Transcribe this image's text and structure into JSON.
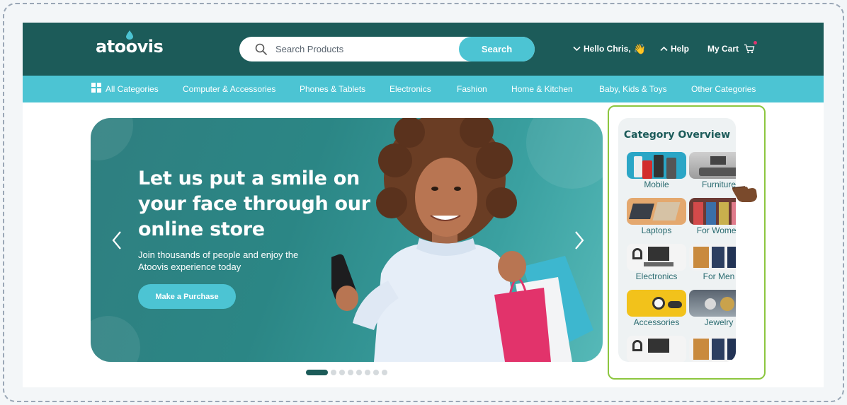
{
  "brand": {
    "logo_text": "atoovis"
  },
  "search": {
    "placeholder": "Search Products",
    "button_label": "Search"
  },
  "header": {
    "greeting": "Hello Chris,",
    "help_label": "Help",
    "cart_label": "My Cart"
  },
  "nav": {
    "all_categories": "All Categories",
    "items": [
      "Computer & Accessories",
      "Phones & Tablets",
      "Electronics",
      "Fashion",
      "Home & Kitchen",
      "Baby, Kids & Toys",
      "Other Categories"
    ]
  },
  "hero": {
    "title": "Let us put a smile on your face through our online store",
    "subtitle": "Join thousands of people and enjoy the Atoovis experience today",
    "cta_label": "Make a Purchase",
    "slide_count": 8,
    "active_slide": 1
  },
  "category_overview": {
    "title": "Category Overview",
    "tiles": [
      "Mobile",
      "Furniture",
      "Laptops",
      "For Women",
      "Electronics",
      "For Men",
      "Accessories",
      "Jewelry"
    ]
  },
  "colors": {
    "brand_dark": "#1c5b59",
    "brand_light": "#4cc4d3",
    "highlight": "#8cc63f",
    "cart_dot": "#e0356f"
  }
}
